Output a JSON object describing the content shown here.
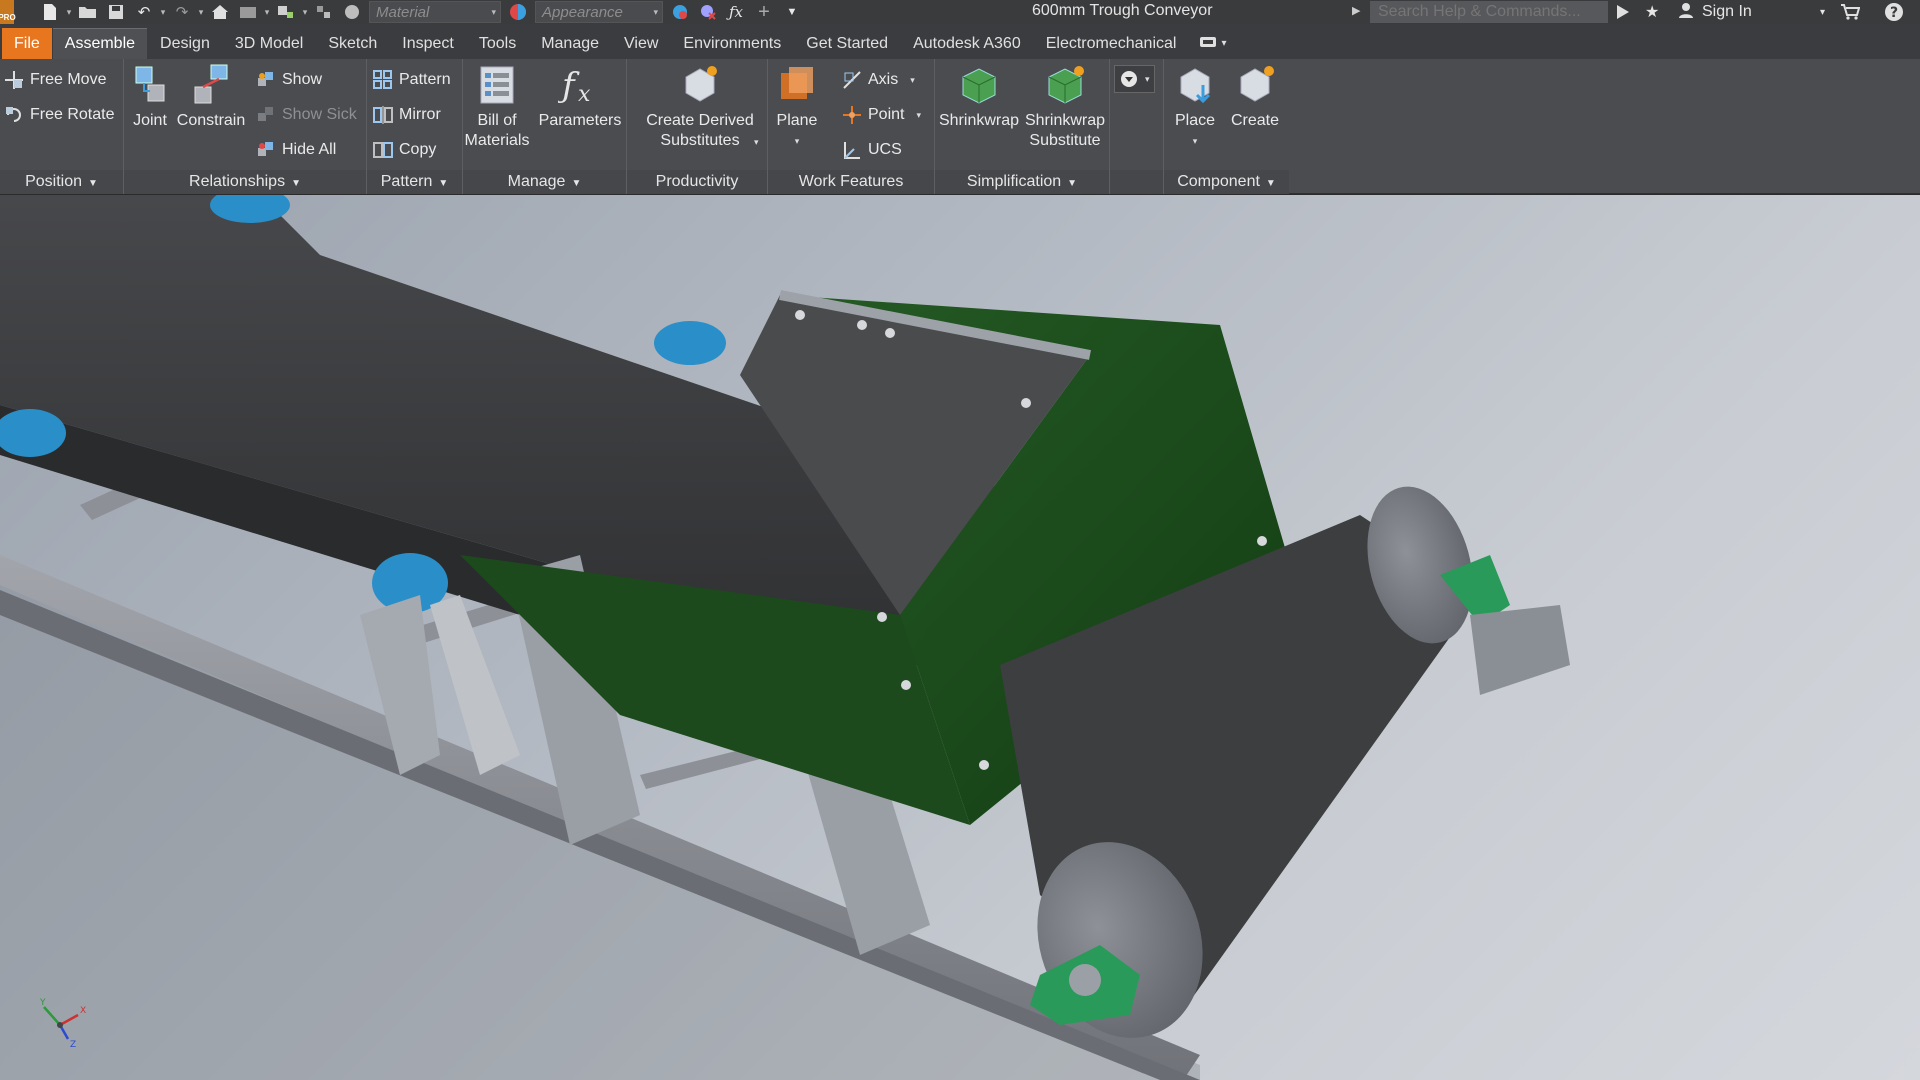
{
  "app": {
    "badge": "PRO",
    "document_title": "600mm Trough Conveyor"
  },
  "quick_access": {
    "material_placeholder": "Material",
    "appearance_placeholder": "Appearance"
  },
  "search": {
    "placeholder": "Search Help & Commands..."
  },
  "account": {
    "sign_in": "Sign In"
  },
  "tabs": [
    {
      "label": "File"
    },
    {
      "label": "Assemble"
    },
    {
      "label": "Design"
    },
    {
      "label": "3D Model"
    },
    {
      "label": "Sketch"
    },
    {
      "label": "Inspect"
    },
    {
      "label": "Tools"
    },
    {
      "label": "Manage"
    },
    {
      "label": "View"
    },
    {
      "label": "Environments"
    },
    {
      "label": "Get Started"
    },
    {
      "label": "Autodesk A360"
    },
    {
      "label": "Electromechanical"
    }
  ],
  "ribbon": {
    "position": {
      "title": "Position",
      "free_move": "Free Move",
      "free_rotate": "Free Rotate"
    },
    "relationships": {
      "title": "Relationships",
      "joint": "Joint",
      "constrain": "Constrain",
      "show": "Show",
      "show_sick": "Show Sick",
      "hide_all": "Hide All"
    },
    "pattern": {
      "title": "Pattern",
      "pattern": "Pattern",
      "mirror": "Mirror",
      "copy": "Copy"
    },
    "manage": {
      "title": "Manage",
      "bom_line1": "Bill of",
      "bom_line2": "Materials",
      "parameters": "Parameters"
    },
    "productivity": {
      "title": "Productivity",
      "cds_line1": "Create Derived",
      "cds_line2": "Substitutes"
    },
    "work_features": {
      "title": "Work Features",
      "plane": "Plane",
      "axis": "Axis",
      "point": "Point",
      "ucs": "UCS"
    },
    "simplification": {
      "title": "Simplification",
      "shrinkwrap": "Shrinkwrap",
      "sws_line1": "Shrinkwrap",
      "sws_line2": "Substitute"
    },
    "component": {
      "title": "Component",
      "place": "Place",
      "create": "Create"
    }
  },
  "triad": {
    "x": "X",
    "y": "Y",
    "z": "Z"
  },
  "colors": {
    "accent_file_tab": "#e8761e",
    "hopper_green": "#1f4d1f",
    "belt": "#3b3c3e",
    "frame": "#8d9096",
    "idler_blue": "#2a8fc8",
    "bearing_green": "#2a9a5a"
  }
}
